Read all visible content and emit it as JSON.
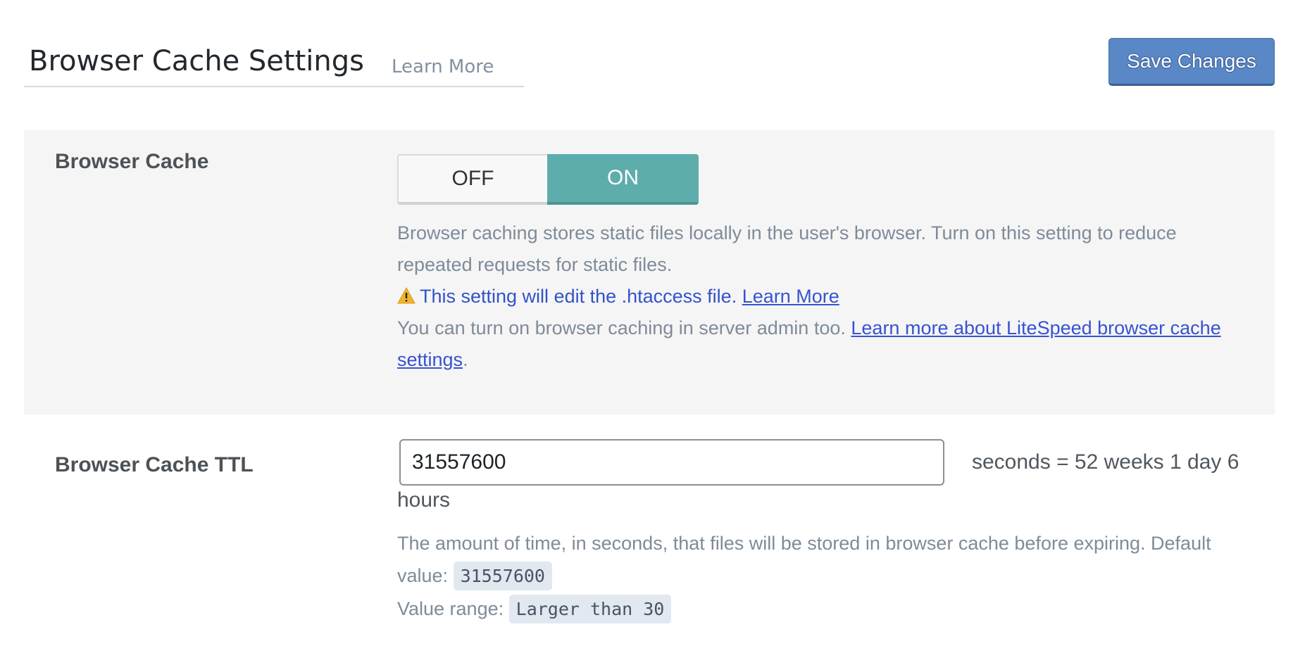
{
  "header": {
    "title": "Browser Cache Settings",
    "learn_more": "Learn More",
    "save_label": "Save Changes"
  },
  "browser_cache": {
    "label": "Browser Cache",
    "toggle": {
      "off_label": "OFF",
      "on_label": "ON",
      "selected": "ON"
    },
    "description": "Browser caching stores static files locally in the user's browser. Turn on this setting to reduce repeated requests for static files.",
    "warning_text": "This setting will edit the .htaccess file.",
    "warning_link": "Learn More",
    "admin_text": "You can turn on browser caching in server admin too.",
    "admin_link": "Learn more about LiteSpeed browser cache settings",
    "admin_end": "."
  },
  "browser_cache_ttl": {
    "label": "Browser Cache TTL",
    "value": "31557600",
    "suffix": "seconds = 52 weeks 1 day 6 hours",
    "description": "The amount of time, in seconds, that files will be stored in browser cache before expiring. Default value:",
    "default_value": "31557600",
    "range_label": "Value range:",
    "range_value": "Larger than 30"
  },
  "colors": {
    "primary": "#5a88c6",
    "toggle_on": "#5eadad",
    "link": "#3753d0",
    "warning": "#f0b429"
  },
  "icons": {
    "warning": "warning-icon"
  }
}
